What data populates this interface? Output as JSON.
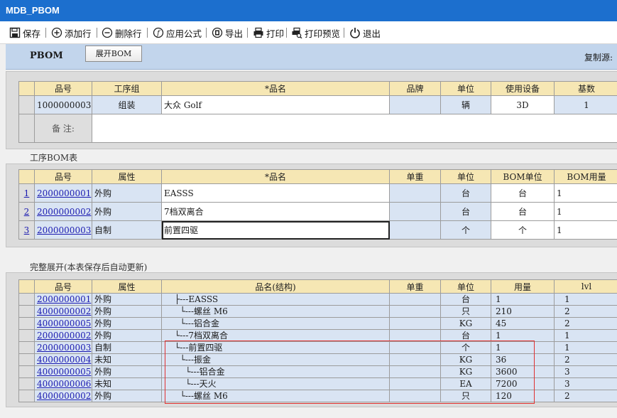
{
  "window": {
    "title": "MDB_PBOM"
  },
  "toolbar": {
    "save": "保存",
    "add_row": "添加行",
    "delete_row": "删除行",
    "apply_formula": "应用公式",
    "export": "导出",
    "print": "打印",
    "print_preview": "打印预览",
    "exit": "退出"
  },
  "header": {
    "title": "PBOM",
    "expand_button": "展开BOM",
    "copy_source_label": "复制源:"
  },
  "main_table": {
    "columns": [
      "品号",
      "工序组",
      "*品名",
      "品牌",
      "单位",
      "使用设备",
      "基数"
    ],
    "row": {
      "part_no": "1000000003",
      "process_group": "组装",
      "name": "大众 Golf",
      "brand": "",
      "unit": "辆",
      "equipment": "3D",
      "base": "1"
    },
    "remark_label": "备  注:",
    "remark_value": ""
  },
  "route_section": {
    "title": "工序BOM表",
    "columns": [
      "品号",
      "属性",
      "*品名",
      "单重",
      "单位",
      "BOM单位",
      "BOM用量"
    ],
    "rows": [
      {
        "idx": "1",
        "part_no": "2000000001",
        "attr": "外购",
        "name": "EASSS",
        "weight": "",
        "unit": "台",
        "bom_unit": "台",
        "qty": "1"
      },
      {
        "idx": "2",
        "part_no": "2000000002",
        "attr": "外购",
        "name": "7档双离合",
        "weight": "",
        "unit": "台",
        "bom_unit": "台",
        "qty": "1"
      },
      {
        "idx": "3",
        "part_no": "2000000003",
        "attr": "自制",
        "name": "前置四驱",
        "weight": "",
        "unit": "个",
        "bom_unit": "个",
        "qty": "1"
      }
    ]
  },
  "full_section": {
    "title": "完整展开(本表保存后自动更新)",
    "columns": [
      "品号",
      "属性",
      "品名(结构)",
      "单重",
      "单位",
      "用量",
      "lvl"
    ],
    "rows": [
      {
        "part_no": "2000000001",
        "attr": "外购",
        "tree": "├---EASSS",
        "weight": "",
        "unit": "台",
        "qty": "1",
        "lvl": "1"
      },
      {
        "part_no": "4000000002",
        "attr": "外购",
        "tree": "  └---螺丝 M6",
        "weight": "",
        "unit": "只",
        "qty": "210",
        "lvl": "2"
      },
      {
        "part_no": "4000000005",
        "attr": "外购",
        "tree": "  └---铝合金",
        "weight": "",
        "unit": "KG",
        "qty": "45",
        "lvl": "2"
      },
      {
        "part_no": "2000000002",
        "attr": "外购",
        "tree": "└---7档双离合",
        "weight": "",
        "unit": "台",
        "qty": "1",
        "lvl": "1"
      },
      {
        "part_no": "2000000003",
        "attr": "自制",
        "tree": "└---前置四驱",
        "weight": "",
        "unit": "个",
        "qty": "1",
        "lvl": "1"
      },
      {
        "part_no": "4000000004",
        "attr": "未知",
        "tree": "  └---振金",
        "weight": "",
        "unit": "KG",
        "qty": "36",
        "lvl": "2"
      },
      {
        "part_no": "4000000005",
        "attr": "外购",
        "tree": "    └---铝合金",
        "weight": "",
        "unit": "KG",
        "qty": "3600",
        "lvl": "3"
      },
      {
        "part_no": "4000000006",
        "attr": "未知",
        "tree": "    └---天火",
        "weight": "",
        "unit": "EA",
        "qty": "7200",
        "lvl": "3"
      },
      {
        "part_no": "4000000002",
        "attr": "外购",
        "tree": "  └---螺丝 M6",
        "weight": "",
        "unit": "只",
        "qty": "120",
        "lvl": "2"
      }
    ],
    "highlight_color": "#e03030"
  },
  "icons": [
    "save-icon",
    "add-icon",
    "delete-icon",
    "formula-icon",
    "export-icon",
    "print-icon",
    "print-preview-icon",
    "exit-icon"
  ]
}
